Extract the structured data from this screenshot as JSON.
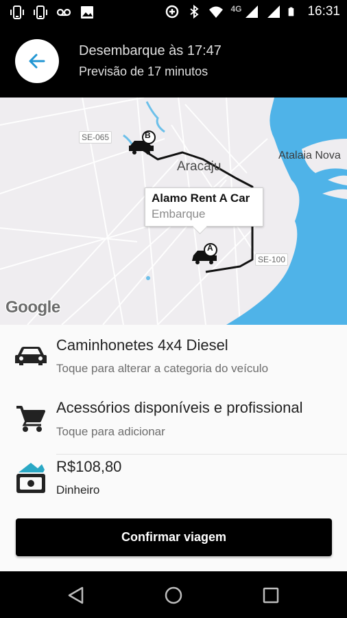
{
  "status_bar": {
    "time": "16:31",
    "network": "4G",
    "left_icons": [
      "phone-vibrate-icon",
      "phone-vibrate-icon",
      "voicemail-icon",
      "image-icon"
    ],
    "right_icons": [
      "data-saver-icon",
      "bluetooth-icon",
      "wifi-icon",
      "signal-icon",
      "signal-icon",
      "battery-icon"
    ]
  },
  "header": {
    "back_icon": "arrow-left-icon",
    "title": "Desembarque às 17:47",
    "subtitle": "Previsão de 17 minutos",
    "accent_color": "#2196d3"
  },
  "map": {
    "labels": {
      "city": "Aracaju",
      "town": "Atalaia Nova",
      "road_1": "SE-065",
      "road_2": "SE-100"
    },
    "popup": {
      "title": "Alamo Rent A Car",
      "subtitle": "Embarque"
    },
    "marker_a": "A",
    "marker_b": "B",
    "attribution": "Google",
    "water_color": "#4fb3e8"
  },
  "options": {
    "vehicle": {
      "icon": "car-icon",
      "title": "Caminhonetes 4x4 Diesel",
      "subtitle": "Toque para alterar a categoria do veículo"
    },
    "accessories": {
      "icon": "cart-icon",
      "title": "Acessórios disponíveis e profissional",
      "subtitle": "Toque para adicionar"
    },
    "payment": {
      "icon": "cash-icon",
      "title": "R$108,80",
      "subtitle": "Dinheiro"
    }
  },
  "confirm_button": {
    "label": "Confirmar viagem"
  },
  "nav_bar": {
    "icons": [
      "back-triangle-icon",
      "home-circle-icon",
      "recents-square-icon"
    ]
  }
}
